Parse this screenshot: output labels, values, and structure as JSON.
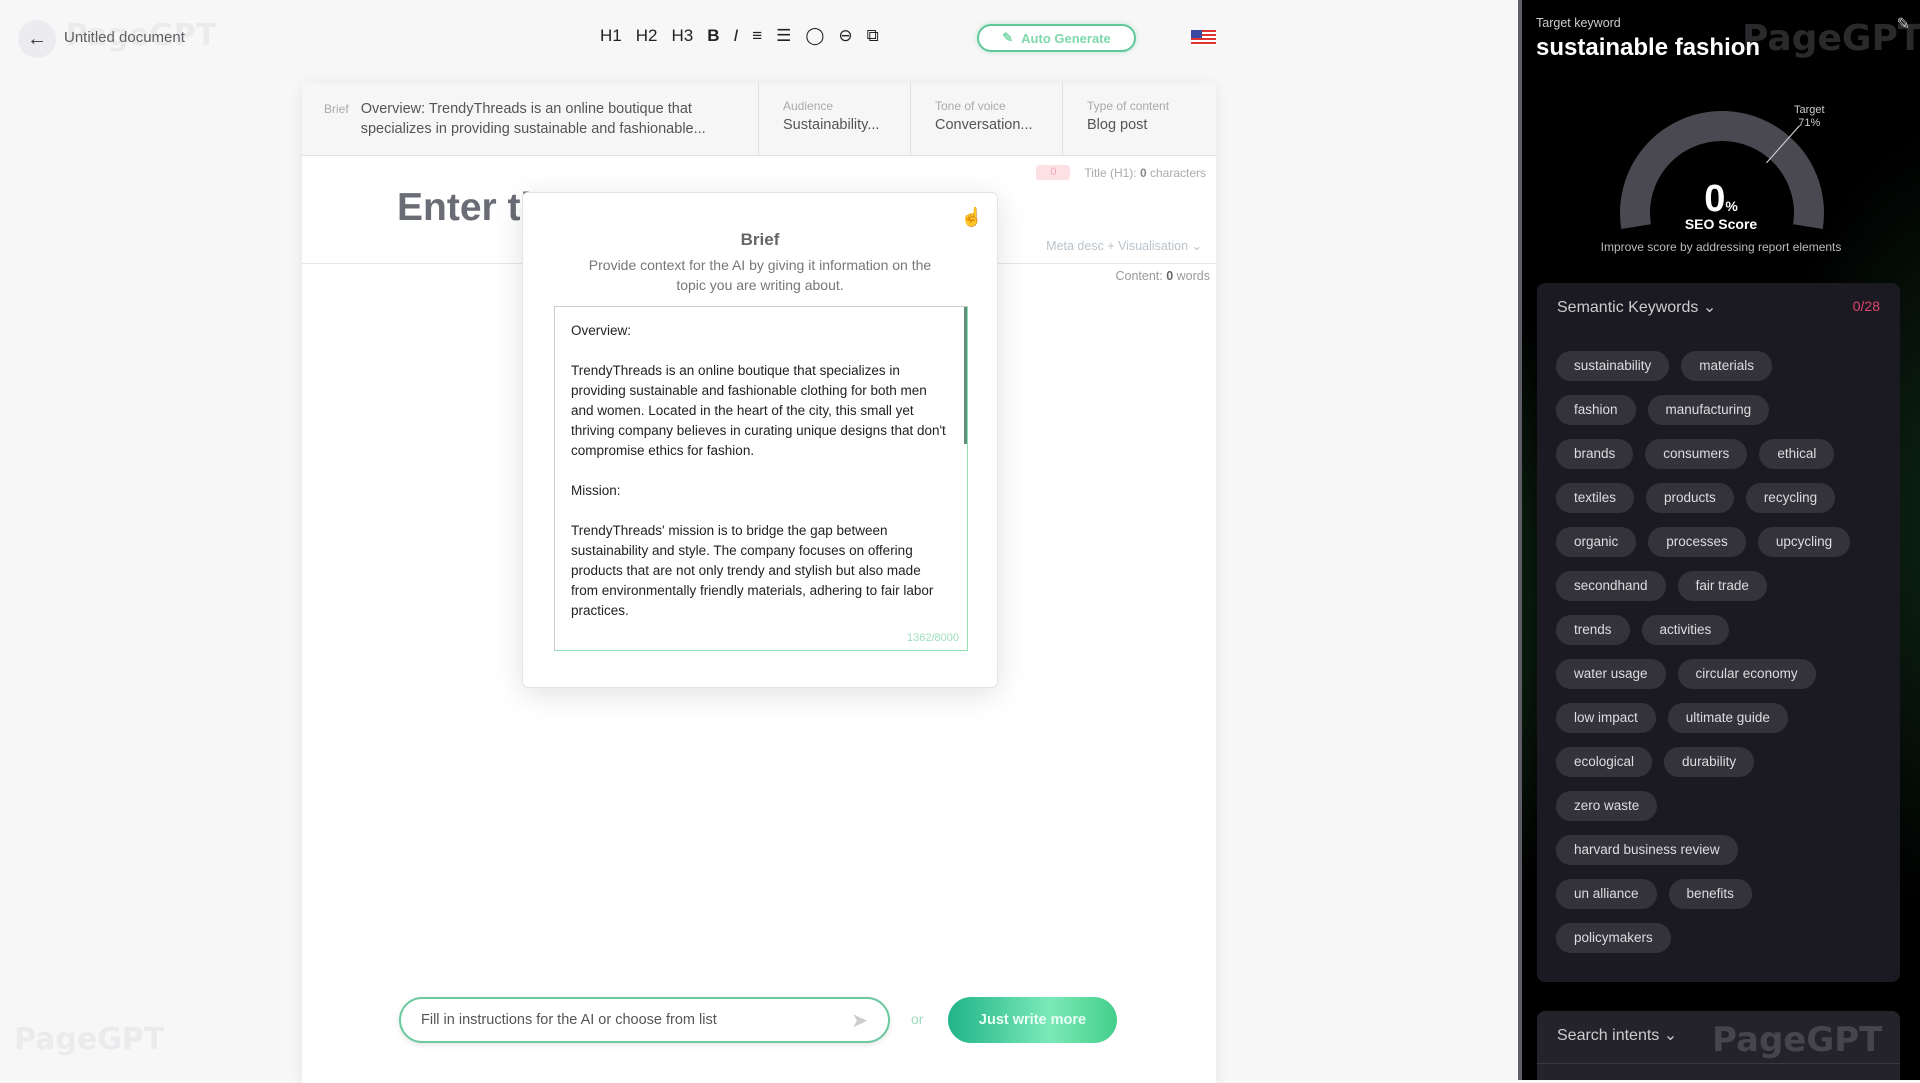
{
  "header": {
    "back_icon": "arrow-left-icon",
    "doc_title": "Untitled document",
    "watermark": "PageGPT",
    "toolbar": [
      "H1",
      "H2",
      "H3",
      "B",
      "I",
      "≡",
      "☰",
      "◯",
      "⊖",
      "⧉"
    ],
    "toolbar_icons": [
      "heading-1",
      "heading-2",
      "heading-3",
      "bold-icon",
      "italic-icon",
      "ordered-list-icon",
      "bullet-list-icon",
      "comment-icon",
      "link-icon",
      "copy-icon"
    ],
    "auto_generate": "Auto Generate",
    "language_flag": "us-flag-icon"
  },
  "brief_bar": {
    "brief_label": "Brief",
    "brief_value": "Overview: TrendyThreads is an online boutique that specializes in providing sustainable and fashionable...",
    "audience_label": "Audience",
    "audience_value": "Sustainability...",
    "tone_label": "Tone of voice",
    "tone_value": "Conversation...",
    "type_label": "Type of content",
    "type_value": "Blog post"
  },
  "editor": {
    "title_badge": "0",
    "title_prefix": "Title (H1): ",
    "title_count": "0",
    "title_suffix": " characters",
    "title_placeholder": "Enter ti",
    "meta": "Meta desc + Visualisation",
    "content_prefix": "Content: ",
    "content_count": "0",
    "content_suffix": " words"
  },
  "modal": {
    "title": "Brief",
    "subtitle": "Provide context for the AI by giving it information on the topic you are writing about.",
    "text": "Overview:\n\nTrendyThreads is an online boutique that specializes in providing sustainable and fashionable clothing for both men and women. Located in the heart of the city, this small yet thriving company believes in curating unique designs that don't compromise ethics for fashion.\n\nMission:\n\nTrendyThreads' mission is to bridge the gap between sustainability and style. The company focuses on offering products that are not only trendy and stylish but also made from environmentally friendly materials, adhering to fair labor practices.",
    "char_count": "1362/8000"
  },
  "bottom": {
    "placeholder": "Fill in instructions for the AI or choose from list",
    "or": "or",
    "just_write": "Just write more"
  },
  "panel": {
    "target_label": "Target keyword",
    "target_keyword": "sustainable fashion",
    "gauge": {
      "score": 0,
      "target": 71,
      "score_text": "0",
      "percent": "%",
      "target_label": "Target",
      "target_text": "71%",
      "label": "SEO Score"
    },
    "improve": "Improve score by addressing report elements",
    "semantic": {
      "title": "Semantic Keywords",
      "count": "0/28",
      "rows": [
        [
          "sustainability",
          "materials"
        ],
        [
          "fashion",
          "manufacturing"
        ],
        [
          "brands",
          "consumers",
          "ethical"
        ],
        [
          "textiles",
          "products",
          "recycling"
        ],
        [
          "organic",
          "processes",
          "upcycling"
        ],
        [
          "secondhand",
          "fair trade"
        ],
        [
          "trends",
          "activities"
        ],
        [
          "water usage",
          "circular economy"
        ],
        [
          "low impact",
          "ultimate guide"
        ],
        [
          "ecological",
          "durability"
        ],
        [
          "zero waste"
        ],
        [
          "harvard business review"
        ],
        [
          "un alliance",
          "benefits"
        ],
        [
          "policymakers"
        ]
      ]
    },
    "search_intents": "Search intents",
    "colors": {
      "accent": "#5fc99a",
      "count_red": "#e0446b",
      "gauge_track": "#4a4850"
    }
  }
}
